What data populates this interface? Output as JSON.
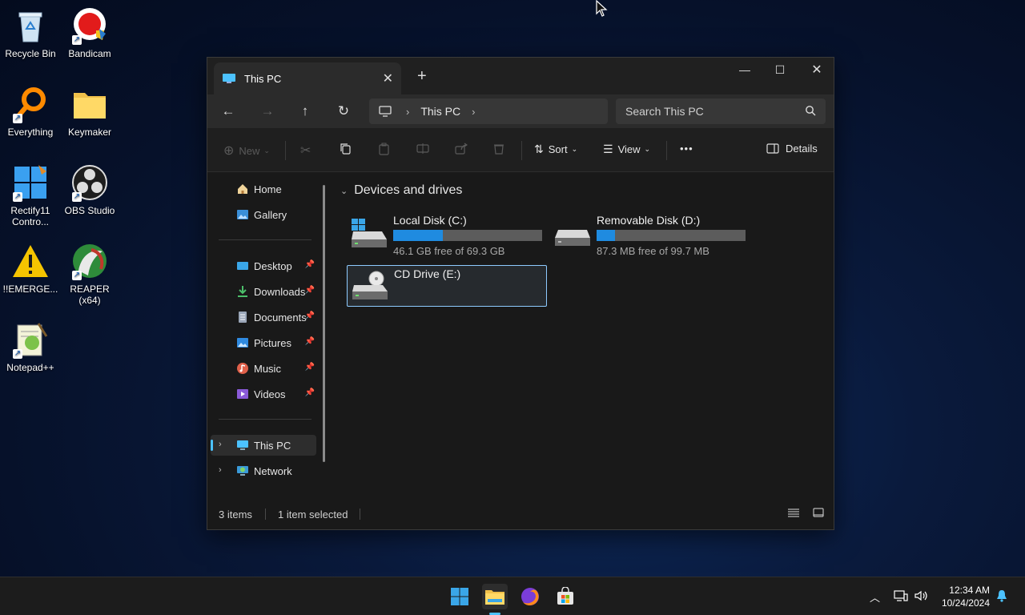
{
  "desktop": {
    "icons": [
      {
        "label": "Recycle Bin"
      },
      {
        "label": "Bandicam"
      },
      {
        "label": "Everything"
      },
      {
        "label": "Keymaker"
      },
      {
        "label": "Rectify11 Contro..."
      },
      {
        "label": "OBS Studio"
      },
      {
        "label": "!!EMERGE..."
      },
      {
        "label": "REAPER (x64)"
      },
      {
        "label": "Notepad++"
      }
    ]
  },
  "window": {
    "tab_title": "This PC",
    "new_tab": "+",
    "nav": {
      "back": "←",
      "forward": "→",
      "up": "↑",
      "refresh": "↻"
    },
    "address": {
      "crumb": "This PC"
    },
    "search": {
      "placeholder": "Search This PC"
    },
    "toolbar": {
      "new_label": "New",
      "sort_label": "Sort",
      "view_label": "View",
      "more_label": "•••",
      "details_label": "Details"
    },
    "sidebar": {
      "home": "Home",
      "gallery": "Gallery",
      "pinned": [
        {
          "label": "Desktop"
        },
        {
          "label": "Downloads"
        },
        {
          "label": "Documents"
        },
        {
          "label": "Pictures"
        },
        {
          "label": "Music"
        },
        {
          "label": "Videos"
        }
      ],
      "this_pc": "This PC",
      "network": "Network"
    },
    "main": {
      "group_title": "Devices and drives",
      "drives": [
        {
          "name": "Local Disk (C:)",
          "free_text": "46.1 GB free of 69.3 GB",
          "used_fraction": 0.335
        },
        {
          "name": "Removable Disk (D:)",
          "free_text": "87.3 MB free of 99.7 MB",
          "used_fraction": 0.124
        },
        {
          "name": "CD Drive (E:)",
          "free_text": "",
          "used_fraction": null
        }
      ]
    },
    "status": {
      "items": "3 items",
      "selected": "1 item selected"
    }
  },
  "taskbar": {
    "clock_time": "12:34 AM",
    "clock_date": "10/24/2024"
  },
  "colors": {
    "accent": "#4cc2ff",
    "drive_bar_fill": "#1f8be0"
  }
}
